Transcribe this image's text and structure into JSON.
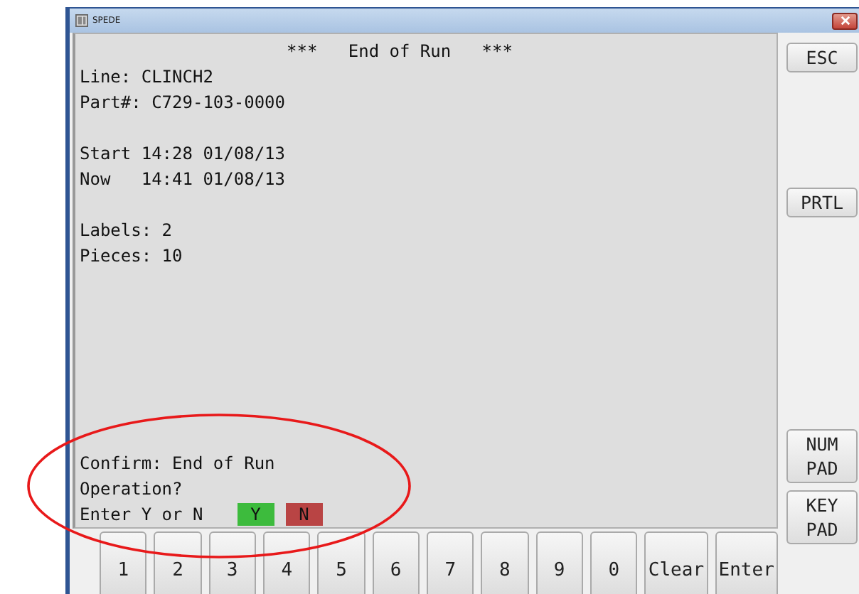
{
  "window": {
    "title": "SPEDE"
  },
  "screen": {
    "heading": "***   End of Run   ***",
    "blocks": [
      [
        "Line: CLINCH2",
        "Part#: C729-103-0000"
      ],
      [
        "Start 14:28 01/08/13",
        "Now   14:41 01/08/13"
      ],
      [
        "Labels: 2",
        "Pieces: 10"
      ]
    ],
    "prompt": [
      "Confirm: End of Run",
      "Operation?",
      "Enter Y or N"
    ],
    "answers": [
      {
        "label": "Y",
        "color": "#3dbb3d"
      },
      {
        "label": "N",
        "color": "#b94444"
      }
    ]
  },
  "side_buttons": [
    {
      "lines": [
        "ESC"
      ],
      "kind": "top"
    },
    {
      "lines": [
        "PRTL"
      ],
      "kind": "middle"
    },
    {
      "lines": [
        "NUM",
        "PAD"
      ],
      "kind": "bottom"
    },
    {
      "lines": [
        "KEY",
        "PAD"
      ],
      "kind": "bottom"
    }
  ],
  "keypad": [
    "1",
    "2",
    "3",
    "4",
    "5",
    "6",
    "7",
    "8",
    "9",
    "0",
    "Clear",
    "Enter"
  ]
}
